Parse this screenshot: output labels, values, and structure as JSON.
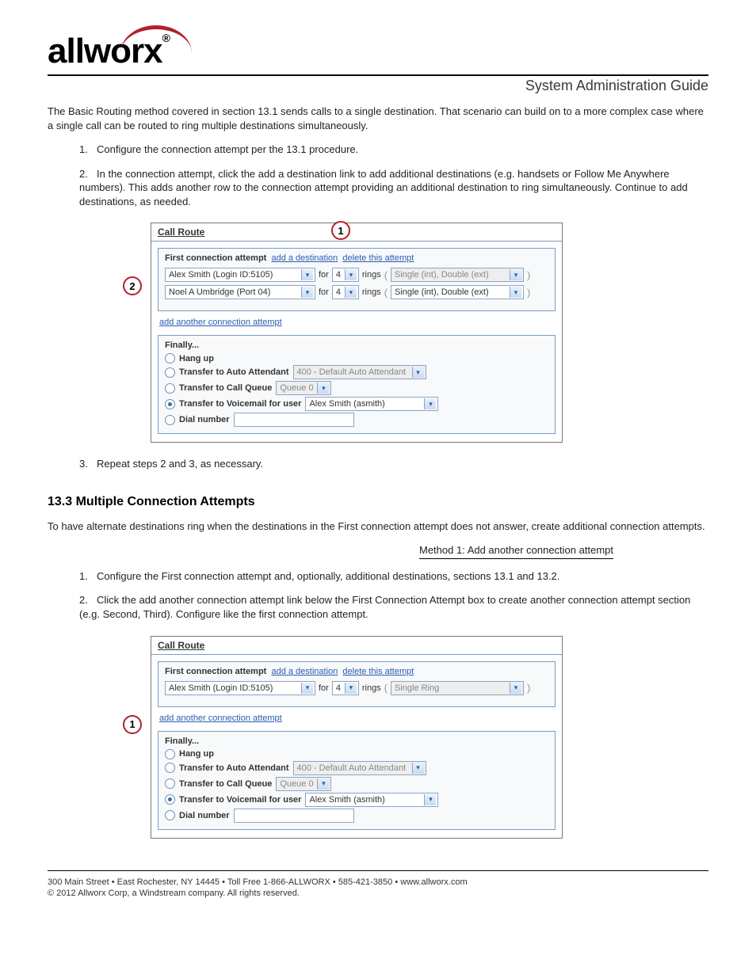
{
  "header": {
    "logo_text": "allworx",
    "doc_title": "System Administration Guide"
  },
  "intro1": "The Basic Routing method covered in section 13.1 sends calls to a single destination. That scenario can build on to a more complex case where a single call can be routed to ring multiple destinations simultaneously.",
  "steps1": [
    "Configure the connection attempt per the 13.1 procedure.",
    "In the connection attempt, click the add a destination link to add additional destinations (e.g. handsets or Follow Me Anywhere numbers). This adds another row to the connection attempt providing an additional destination to ring simultaneously. Continue to add destinations, as needed."
  ],
  "steps2": [
    "Repeat steps 2 and 3, as necessary."
  ],
  "panel1": {
    "title": "Call Route",
    "first_attempt": "First connection attempt",
    "add_dest": "add a destination",
    "delete_attempt": "delete this attempt",
    "rows": [
      {
        "name": "Alex Smith (Login ID:5105)",
        "for": "for",
        "num": "4",
        "rings": "rings",
        "paren_l": "(",
        "ring_type": "Single (int), Double (ext)",
        "paren_r": ")",
        "disabled": true
      },
      {
        "name": "Noel A Umbridge (Port 04)",
        "for": "for",
        "num": "4",
        "rings": "rings",
        "paren_l": "(",
        "ring_type": "Single (int), Double (ext)",
        "paren_r": ")",
        "disabled": false
      }
    ],
    "add_another": "add another connection attempt",
    "finally": {
      "title": "Finally...",
      "hangup": "Hang up",
      "transfer_aa": "Transfer to Auto Attendant",
      "aa_sel": "400 - Default Auto Attendant",
      "transfer_cq": "Transfer to Call Queue",
      "cq_sel": "Queue 0",
      "transfer_vm": "Transfer to Voicemail for user",
      "vm_sel": "Alex Smith (asmith)",
      "dial": "Dial number"
    }
  },
  "section2": {
    "title": "13.3 Multiple Connection Attempts",
    "intro": "To have alternate destinations ring when the destinations in the First connection attempt does not answer, create additional connection attempts.",
    "method": "Method 1: Add another connection attempt",
    "steps": [
      "Configure the First connection attempt and, optionally, additional destinations, sections 13.1 and 13.2.",
      "Click the add another connection attempt link below the First Connection Attempt box to create another connection attempt section (e.g. Second, Third). Configure like the first connection attempt."
    ]
  },
  "panel2": {
    "title": "Call Route",
    "first_attempt": "First connection attempt",
    "add_dest": "add a destination",
    "delete_attempt": "delete this attempt",
    "rows": [
      {
        "name": "Alex Smith (Login ID:5105)",
        "for": "for",
        "num": "4",
        "rings": "rings",
        "paren_l": "(",
        "ring_type": "Single Ring",
        "paren_r": ")",
        "disabled": true
      }
    ],
    "add_another": "add another connection attempt",
    "finally": {
      "title": "Finally...",
      "hangup": "Hang up",
      "transfer_aa": "Transfer to Auto Attendant",
      "aa_sel": "400 - Default Auto Attendant",
      "transfer_cq": "Transfer to Call Queue",
      "cq_sel": "Queue 0",
      "transfer_vm": "Transfer to Voicemail for user",
      "vm_sel": "Alex Smith (asmith)",
      "dial": "Dial number"
    }
  },
  "footer": {
    "left": "300 Main Street • East Rochester, NY 14445 • Toll Free 1-866-ALLWORX • 585-421-3850 • www.allworx.com",
    "right": "© 2012 Allworx Corp, a Windstream company. All rights reserved."
  },
  "callouts": {
    "c1": "1",
    "c2": "2",
    "c3": "1"
  }
}
